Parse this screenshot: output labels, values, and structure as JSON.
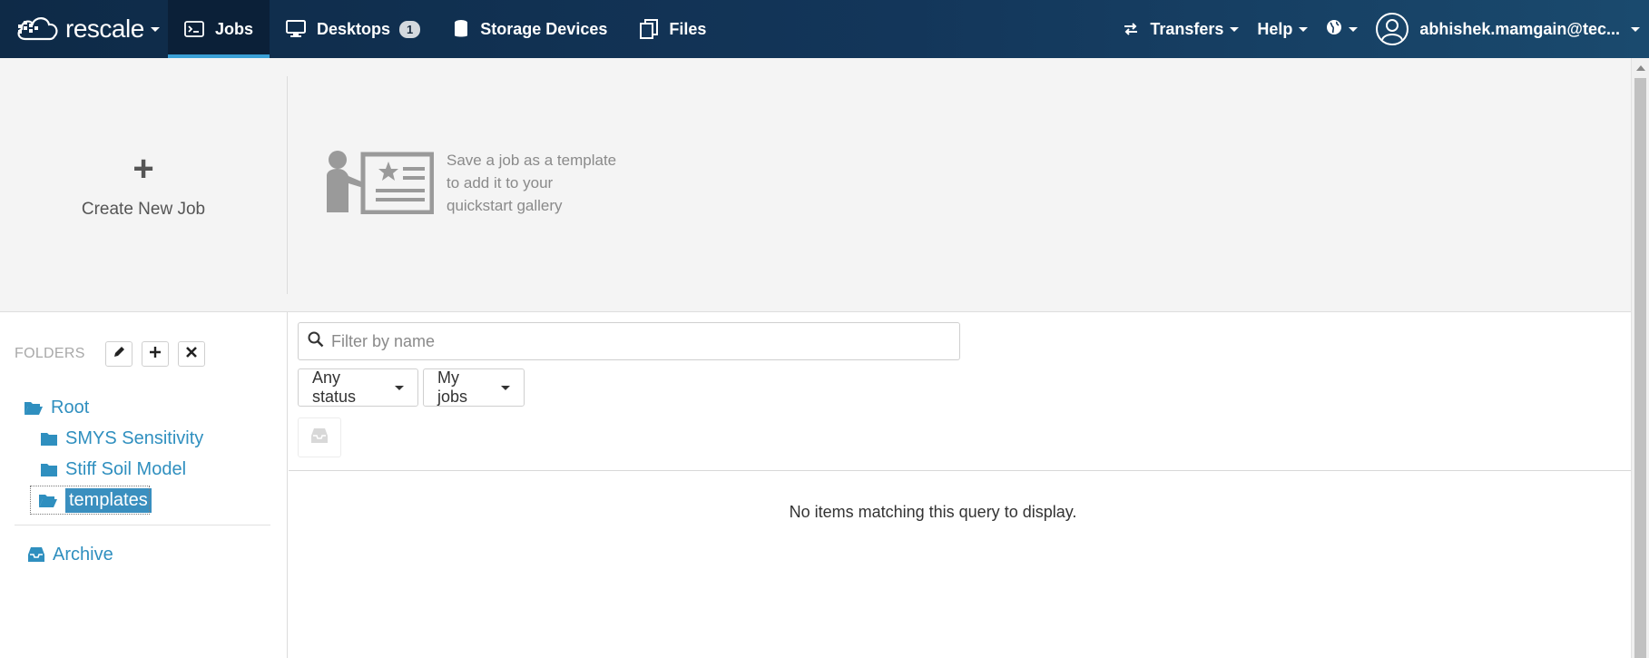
{
  "navbar": {
    "brand": "rescale",
    "tabs": [
      {
        "label": "Jobs",
        "icon": "terminal-icon"
      },
      {
        "label": "Desktops",
        "icon": "monitor-icon",
        "badge": "1"
      },
      {
        "label": "Storage Devices",
        "icon": "database-icon"
      },
      {
        "label": "Files",
        "icon": "files-icon"
      }
    ],
    "right": {
      "transfers": "Transfers",
      "help": "Help",
      "user": "abhishek.mamgain@tec..."
    },
    "colors": {
      "bar": "#0e2a47",
      "active_underline": "#3aa0d6"
    }
  },
  "quickstart": {
    "create_plus": "+",
    "create_label": "Create New Job",
    "hint": [
      "Save a job as a template",
      "to add it to your",
      "quickstart gallery"
    ]
  },
  "sidebar": {
    "folders_label": "FOLDERS",
    "root": "Root",
    "children": [
      "SMYS Sensitivity",
      "Stiff Soil Model",
      "templates"
    ],
    "archive": "Archive",
    "link_color": "#2f8fbf"
  },
  "main": {
    "filter_placeholder": "Filter by name",
    "status_dropdown": "Any status",
    "owner_dropdown": "My jobs",
    "empty_message": "No items matching this query to display."
  }
}
